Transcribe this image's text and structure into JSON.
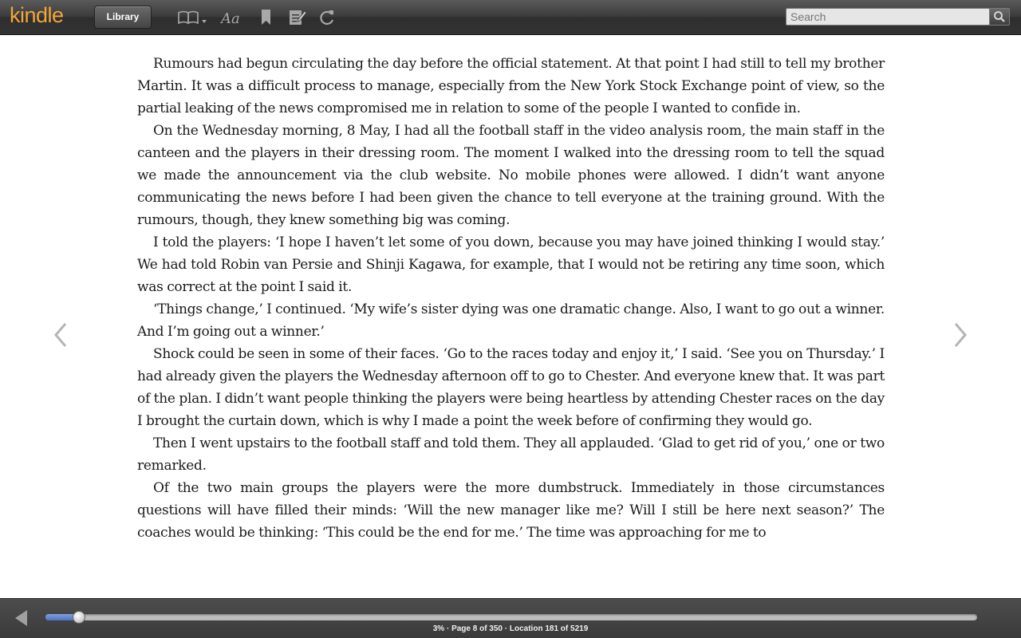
{
  "toolbar": {
    "logo": "kindle",
    "library_label": "Library",
    "icons": [
      "book-menu-icon",
      "font-size-icon",
      "bookmark-icon",
      "notes-icon",
      "sync-icon"
    ]
  },
  "search": {
    "placeholder": "Search",
    "icon": "search-icon"
  },
  "book": {
    "paragraphs": [
      "Rumours had begun circulating the day before the official statement. At that point I had still to tell my brother Martin. It was a difficult process to manage, especially from the New York Stock Exchange point of view, so the partial leaking of the news compromised me in relation to some of the people I wanted to confide in.",
      "On the Wednesday morning, 8 May, I had all the football staff in the video analysis room, the main staff in the canteen and the players in their dressing room. The moment I walked into the dressing room to tell the squad we made the announcement via the club website. No mobile phones were allowed. I didn’t want anyone communicating the news before I had been given the chance to tell everyone at the training ground. With the rumours, though, they knew something big was coming.",
      "I told the players: ‘I hope I haven’t let some of you down, because you may have joined thinking I would stay.’ We had told Robin van Persie and Shinji Kagawa, for example, that I would not be retiring any time soon, which was correct at the point I said it.",
      "‘Things change,’ I continued. ‘My wife’s sister dying was one dramatic change. Also, I want to go out a winner. And I’m going out a winner.’",
      "Shock could be seen in some of their faces. ‘Go to the races today and enjoy it,’ I said. ‘See you on Thursday.’ I had already given the players the Wednesday afternoon off to go to Chester. And everyone knew that. It was part of the plan. I didn’t want people thinking the players were being heartless by attending Chester races on the day I brought the curtain down, which is why I made a point the week before of confirming they would go.",
      "Then I went upstairs to the football staff and told them. They all applauded. ‘Glad to get rid of you,’ one or two remarked.",
      "Of the two main groups the players were the more dumbstruck. Immediately in those circumstances questions will have filled their minds: ‘Will the new manager like me? Will I still be here next season?’ The coaches would be thinking: ‘This could be the end for me.’ The time was approaching for me to"
    ]
  },
  "navigation": {
    "prev_icon": "chevron-left-icon",
    "next_icon": "chevron-right-icon"
  },
  "footer": {
    "back_icon": "back-arrow-icon",
    "progress_fraction": 0.036,
    "location_text": "3% · Page 8 of 350 · Location 181 of 5219"
  },
  "colors": {
    "brand": "#f3a539",
    "progress": "#5b7fd0"
  }
}
